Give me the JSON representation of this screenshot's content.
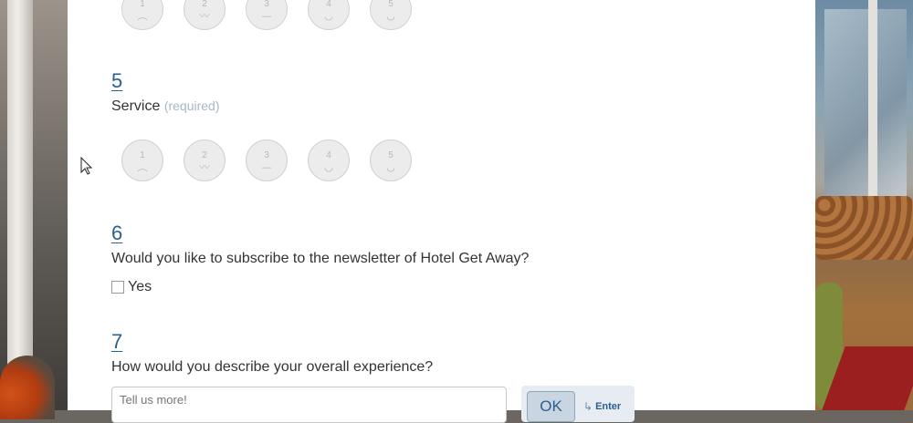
{
  "rating_scale": [
    {
      "number": "1",
      "face": "︵"
    },
    {
      "number": "2",
      "face": "〰"
    },
    {
      "number": "3",
      "face": "—"
    },
    {
      "number": "4",
      "face": "◡"
    },
    {
      "number": "5",
      "face": "◡"
    }
  ],
  "questions": {
    "q5": {
      "number": "5",
      "text": "Service",
      "required": "(required)"
    },
    "q6": {
      "number": "6",
      "text": "Would you like to subscribe to the newsletter of Hotel Get Away?",
      "option": "Yes",
      "checked": false
    },
    "q7": {
      "number": "7",
      "text": "How would you describe your overall experience?",
      "placeholder": "Tell us more!"
    }
  },
  "actions": {
    "ok_label": "OK",
    "enter_hint": "Enter"
  }
}
